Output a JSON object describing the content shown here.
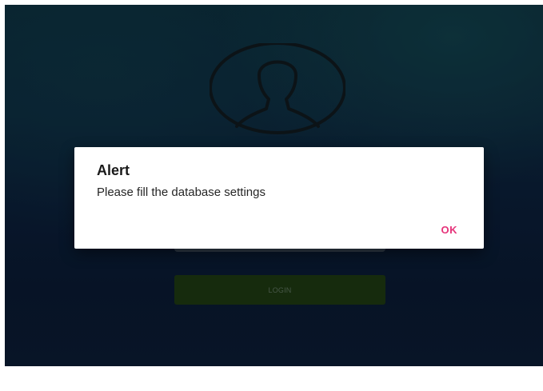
{
  "login_screen": {
    "avatar_icon": "user-avatar-icon",
    "login_button_label": "LOGIN"
  },
  "alert_dialog": {
    "title": "Alert",
    "message": "Please fill the database settings",
    "ok_label": "OK"
  },
  "colors": {
    "ok_accent": "#e6337a",
    "login_button": "#1e3a12",
    "background": "#0b1f3a"
  }
}
